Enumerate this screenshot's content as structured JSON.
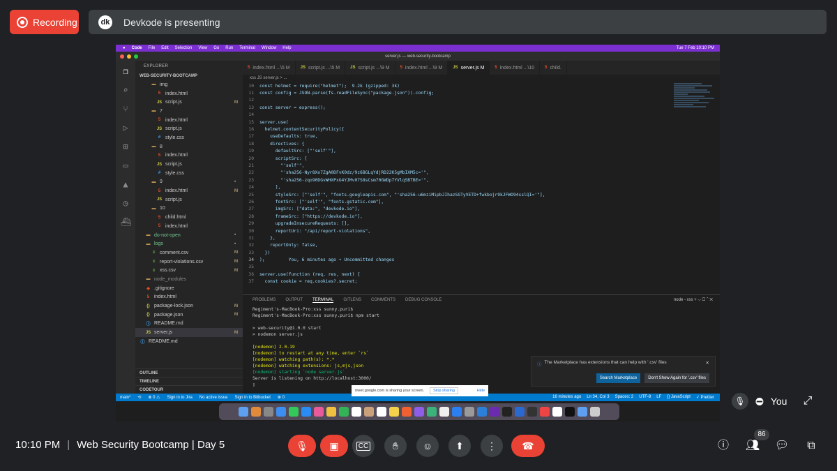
{
  "meet": {
    "recording_label": "Recording",
    "presenter_text": "Devkode is presenting",
    "presenter_avatar": "dk",
    "time": "10:10 PM",
    "separator": "|",
    "meeting_title": "Web Security Bootcamp | Day 5",
    "self_label": "You",
    "participants_count": "86",
    "accent": "#ea4335"
  },
  "mac": {
    "menu": [
      "Code",
      "File",
      "Edit",
      "Selection",
      "View",
      "Go",
      "Run",
      "Terminal",
      "Window",
      "Help"
    ],
    "clock": "Tue 7 Feb  10:10 PM"
  },
  "vscode": {
    "window_title": "server.js — web-security-bootcamp",
    "explorer_header": "EXPLORER",
    "project_name": "WEB-SECURITY-BOOTCAMP",
    "tree": [
      {
        "icon": "folder",
        "name": "img",
        "indent": 2,
        "badge": ""
      },
      {
        "icon": "html",
        "name": "index.html",
        "indent": 3,
        "badge": ""
      },
      {
        "icon": "js",
        "name": "script.js",
        "indent": 3,
        "badge": "M"
      },
      {
        "icon": "folder",
        "name": "7",
        "indent": 2,
        "badge": ""
      },
      {
        "icon": "html",
        "name": "index.html",
        "indent": 3,
        "badge": ""
      },
      {
        "icon": "js",
        "name": "script.js",
        "indent": 3,
        "badge": ""
      },
      {
        "icon": "css",
        "name": "style.css",
        "indent": 3,
        "badge": ""
      },
      {
        "icon": "folder",
        "name": "8",
        "indent": 2,
        "badge": ""
      },
      {
        "icon": "html",
        "name": "index.html",
        "indent": 3,
        "badge": ""
      },
      {
        "icon": "js",
        "name": "script.js",
        "indent": 3,
        "badge": ""
      },
      {
        "icon": "css",
        "name": "style.css",
        "indent": 3,
        "badge": ""
      },
      {
        "icon": "folder",
        "name": "9",
        "indent": 2,
        "badge": "•"
      },
      {
        "icon": "html",
        "name": "index.html",
        "indent": 3,
        "badge": "M"
      },
      {
        "icon": "js",
        "name": "script.js",
        "indent": 3,
        "badge": ""
      },
      {
        "icon": "folder",
        "name": "10",
        "indent": 2,
        "badge": ""
      },
      {
        "icon": "html",
        "name": "child.html",
        "indent": 3,
        "badge": ""
      },
      {
        "icon": "html",
        "name": "index.html",
        "indent": 3,
        "badge": ""
      },
      {
        "icon": "folder",
        "name": "do-not-open",
        "indent": 1,
        "badge": "•"
      },
      {
        "icon": "folder",
        "name": "logs",
        "indent": 1,
        "badge": "•"
      },
      {
        "icon": "csv",
        "name": "comment.csv",
        "indent": 2,
        "badge": "M"
      },
      {
        "icon": "csv",
        "name": "report-violations.csv",
        "indent": 2,
        "badge": "M"
      },
      {
        "icon": "csv",
        "name": "xss.csv",
        "indent": 2,
        "badge": "M"
      },
      {
        "icon": "folder",
        "name": "node_modules",
        "indent": 1,
        "badge": ""
      },
      {
        "icon": "git",
        "name": ".gitignore",
        "indent": 1,
        "badge": ""
      },
      {
        "icon": "html",
        "name": "index.html",
        "indent": 1,
        "badge": ""
      },
      {
        "icon": "json",
        "name": "package-lock.json",
        "indent": 1,
        "badge": "M"
      },
      {
        "icon": "json",
        "name": "package.json",
        "indent": 1,
        "badge": "M"
      },
      {
        "icon": "md",
        "name": "README.md",
        "indent": 1,
        "badge": ""
      },
      {
        "icon": "js",
        "name": "server.js",
        "indent": 1,
        "badge": "M",
        "selected": true
      },
      {
        "icon": "md",
        "name": "README.md",
        "indent": 0,
        "badge": ""
      }
    ],
    "outline_sections": [
      "OUTLINE",
      "TIMELINE",
      "CODETOUR"
    ],
    "tabs": [
      {
        "icon": "html",
        "label": "index.html ...\\5 M",
        "active": false
      },
      {
        "icon": "js",
        "label": "script.js ...\\5 M",
        "active": false
      },
      {
        "icon": "js",
        "label": "script.js ...\\9 M",
        "active": false
      },
      {
        "icon": "html",
        "label": "index.html ...\\9 M",
        "active": false
      },
      {
        "icon": "js",
        "label": "server.js M",
        "active": true
      },
      {
        "icon": "html",
        "label": "index.html ...\\10",
        "active": false
      },
      {
        "icon": "html",
        "label": "child.",
        "active": false
      }
    ],
    "breadcrumb": "xss  JS server.js > ...",
    "code_lines": [
      {
        "n": "10",
        "t": "const helmet = require(\"helmet\");  9.2k (gzipped: 3k)"
      },
      {
        "n": "11",
        "t": "const config = JSON.parse(fs.readFileSync(\"package.json\")).config;"
      },
      {
        "n": "12",
        "t": ""
      },
      {
        "n": "13",
        "t": "const server = express();"
      },
      {
        "n": "14",
        "t": ""
      },
      {
        "n": "15",
        "t": "server.use("
      },
      {
        "n": "16",
        "t": "  helmet.contentSecurityPolicy({"
      },
      {
        "n": "17",
        "t": "    useDefaults: true,"
      },
      {
        "n": "18",
        "t": "    directives: {"
      },
      {
        "n": "19",
        "t": "      defaultSrc: [\"'self'\"],"
      },
      {
        "n": "20",
        "t": "      scriptSrc: ["
      },
      {
        "n": "21",
        "t": "        \"'self'\","
      },
      {
        "n": "22",
        "t": "        \"'sha256-Nyr8Xo7ZgA0DFvK0dz/9z6BGLqYdjRD22K5gMbIXM5c='\","
      },
      {
        "n": "23",
        "t": "        \"'sha256-zqo90DGvWHXPxG4YJMv07S8sCsm70GWDp7YVlqSBTBE='\","
      },
      {
        "n": "24",
        "t": "      ],"
      },
      {
        "n": "25",
        "t": "      styleSrc: [\"'self'\", \"fonts.googleapis.com\", \"'sha256-u6mziMipbJIhazSGTyVETD+fwkbojr9kJFWO94sslQI='\"],"
      },
      {
        "n": "26",
        "t": "      fontSrc: [\"'self'\", \"fonts.gstatic.com\"],"
      },
      {
        "n": "27",
        "t": "      imgSrc: [\"data:\", \"devkode.io\"],"
      },
      {
        "n": "28",
        "t": "      frameSrc: [\"https://devkode.io\"],"
      },
      {
        "n": "29",
        "t": "      upgradeInsecureRequests: [],"
      },
      {
        "n": "30",
        "t": "      reportUri: \"/api/report-violations\","
      },
      {
        "n": "31",
        "t": "    },"
      },
      {
        "n": "32",
        "t": "    reportOnly: false,"
      },
      {
        "n": "33",
        "t": "  })"
      },
      {
        "n": "34",
        "t": ");         You, 6 minutes ago • Uncommitted changes",
        "current": true
      },
      {
        "n": "35",
        "t": ""
      },
      {
        "n": "36",
        "t": "server.use(function (req, res, next) {"
      },
      {
        "n": "37",
        "t": "  const cookie = req.cookies?.secret;"
      }
    ],
    "panel_tabs": [
      "PROBLEMS",
      "OUTPUT",
      "TERMINAL",
      "GITLENS",
      "COMMENTS",
      "DEBUG CONSOLE"
    ],
    "panel_active": "TERMINAL",
    "terminal_selector": "node - xss  + ⌵  ▢  ⌃  ✕",
    "terminal_lines": [
      {
        "t": "Regiment's-MacBook-Pro:xss sunny.puri$",
        "c": ""
      },
      {
        "t": "Regiment's-MacBook-Pro:xss sunny.puri$ npm start",
        "c": ""
      },
      {
        "t": "",
        "c": ""
      },
      {
        "t": "> web-security@1.0.0 start",
        "c": ""
      },
      {
        "t": "> nodemon server.js",
        "c": ""
      },
      {
        "t": "",
        "c": ""
      },
      {
        "t": "[nodemon] 2.0.19",
        "c": "y"
      },
      {
        "t": "[nodemon] to restart at any time, enter `rs`",
        "c": "y"
      },
      {
        "t": "[nodemon] watching path(s): *.*",
        "c": "y"
      },
      {
        "t": "[nodemon] watching extensions: js,mjs,json",
        "c": "y"
      },
      {
        "t": "[nodemon] starting `node server.js`",
        "c": "g"
      },
      {
        "t": "Server is listening on http://localhost:3000/",
        "c": ""
      },
      {
        "t": "▯",
        "c": ""
      }
    ],
    "notification": {
      "text": "The Marketplace has extensions that can help with '.csv' files",
      "primary": "Search Marketplace",
      "secondary": "Don't Show Again for '.csv' files"
    },
    "status_left": [
      "main*",
      "⟲",
      "⊗ 0 ⚠",
      "Sign in to Jira",
      "No active issue",
      "Sign in to Bitbucket",
      "⊗ 0"
    ],
    "status_right": [
      "16 minutes ago",
      "Ln 34, Col 3",
      "Spaces: 2",
      "UTF-8",
      "LF",
      "{} JavaScript",
      "✓ Prettier"
    ]
  },
  "share_bar": {
    "text": "meet.google.com is sharing your screen.",
    "stop": "Stop sharing",
    "hide": "Hide"
  },
  "controls": {
    "mic_off": "mic-off-icon",
    "cam_off": "videocam-off-icon",
    "captions": "CC",
    "raise_hand": "hand-icon",
    "emoji": "emoji-icon",
    "present": "present-icon",
    "more": "more-vert-icon",
    "leave": "call-end-icon"
  }
}
